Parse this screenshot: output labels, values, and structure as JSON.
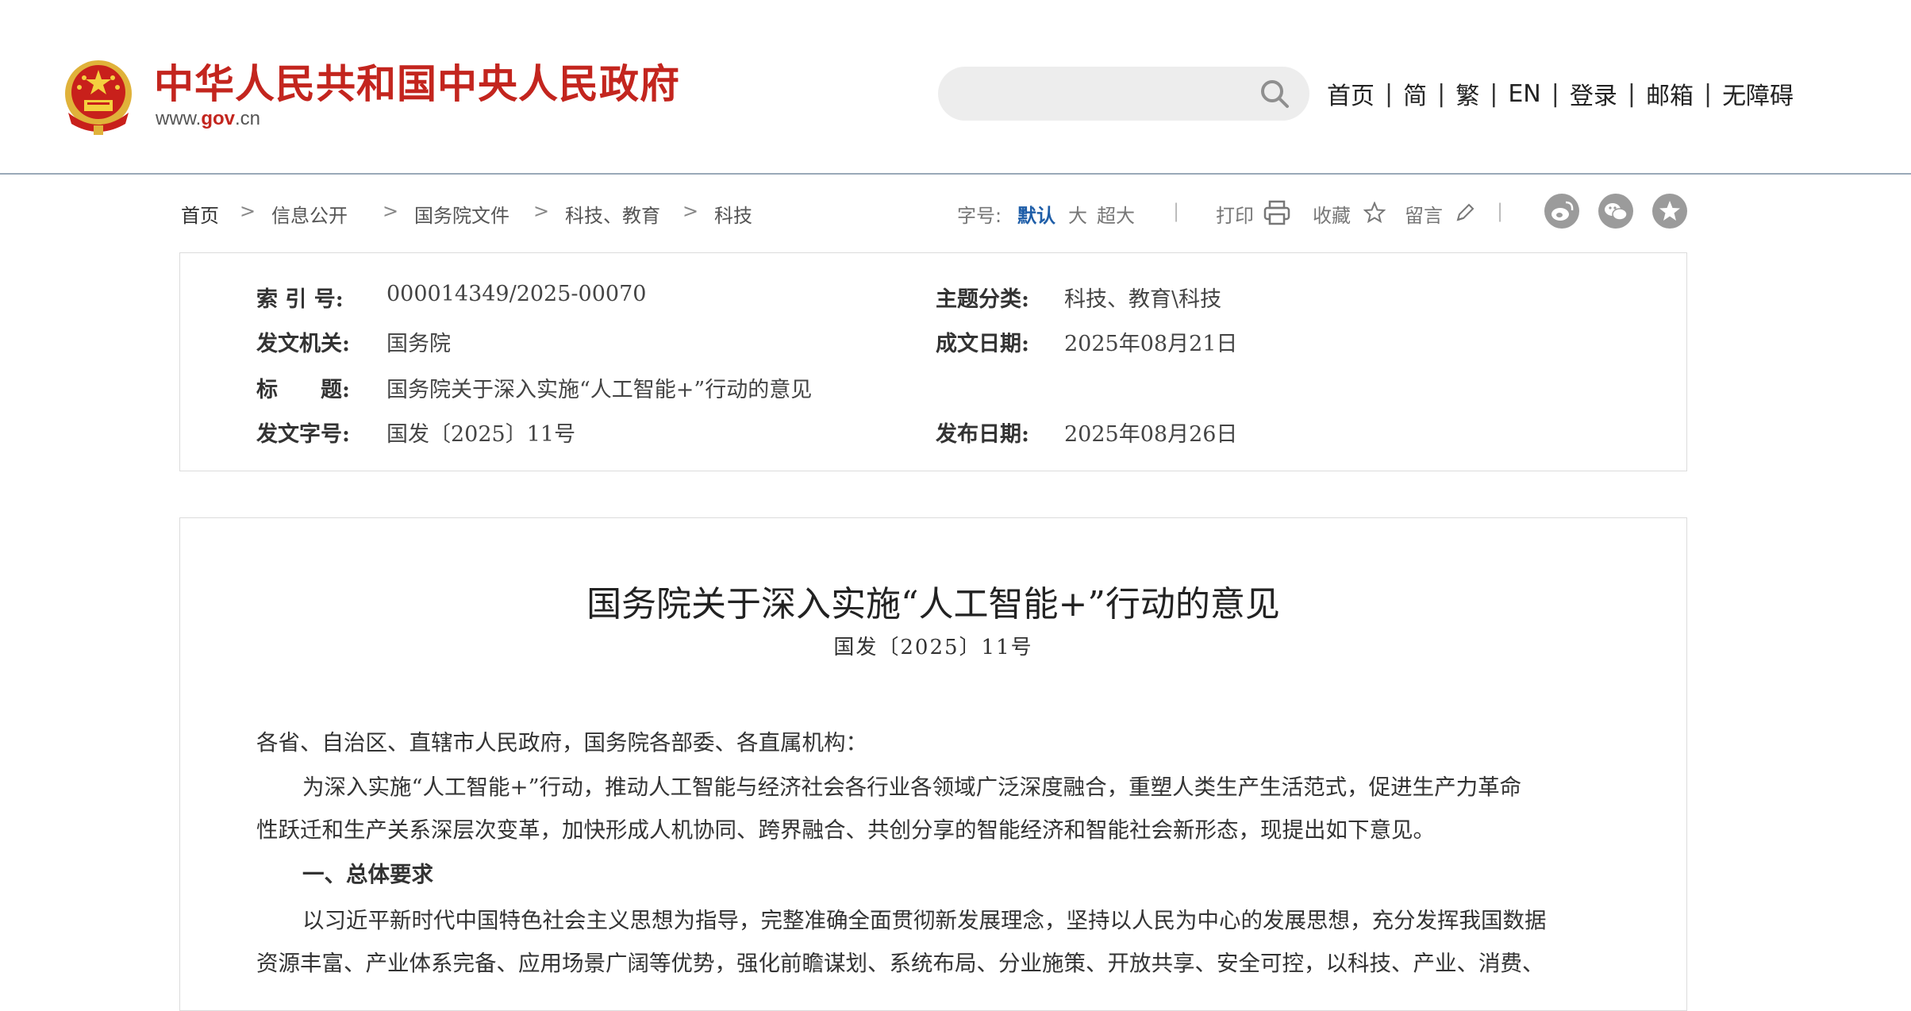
{
  "header": {
    "site_title": "中华人民共和国中央人民政府",
    "domain_prefix": "www.",
    "domain_gov": "gov",
    "domain_suffix": ".cn",
    "search": {
      "placeholder": "",
      "value": ""
    },
    "nav": [
      "首页",
      "简",
      "繁",
      "EN",
      "登录",
      "邮箱",
      "无障碍"
    ],
    "nav_separator": "|"
  },
  "breadcrumb": {
    "items": [
      "首页",
      "信息公开",
      "国务院文件",
      "科技、教育",
      "科技"
    ],
    "chevron": ">"
  },
  "tools": {
    "font_label": "字号:",
    "font_default": "默认",
    "font_large": "大",
    "font_xlarge": "超大",
    "print": "打印",
    "favorite": "收藏",
    "comment": "留言",
    "divider": "|",
    "share_icons": [
      "weibo-icon",
      "wechat-icon",
      "favorite-share-icon"
    ]
  },
  "info": {
    "index_label": "索 引 号:",
    "index_value": "000014349/2025-00070",
    "topic_label": "主题分类:",
    "topic_value": "科技、教育\\科技",
    "issuer_label": "发文机关:",
    "issuer_value": "国务院",
    "written_label": "成文日期:",
    "written_value": "2025年08月21日",
    "title_label": "标　　题:",
    "title_value": "国务院关于深入实施“人工智能+”行动的意见",
    "docno_label": "发文字号:",
    "docno_value": "国发〔2025〕11号",
    "published_label": "发布日期:",
    "published_value": "2025年08月26日"
  },
  "article": {
    "title": "国务院关于深入实施“人工智能+”行动的意见",
    "doc_number": "国发〔2025〕11号",
    "salutation": "各省、自治区、直辖市人民政府，国务院各部委、各直属机构：",
    "para1_line1": "为深入实施“人工智能+”行动，推动人工智能与经济社会各行业各领域广泛深度融合，重塑人类生产生活范式，促进生产力革命",
    "para1_line2": "性跃迁和生产关系深层次变革，加快形成人机协同、跨界融合、共创分享的智能经济和智能社会新形态，现提出如下意见。",
    "section1_heading": "一、总体要求",
    "para2_line1": "以习近平新时代中国特色社会主义思想为指导，完整准确全面贯彻新发展理念，坚持以人民为中心的发展思想，充分发挥我国数据",
    "para2_line2": "资源丰富、产业体系完备、应用场景广阔等优势，强化前瞻谋划、系统布局、分业施策、开放共享、安全可控，以科技、产业、消费、"
  },
  "colors": {
    "brand_red": "#c3251e",
    "link_blue": "#1f5ea8",
    "search_bg": "#ededed",
    "icon_gray": "#9b9b9b"
  }
}
